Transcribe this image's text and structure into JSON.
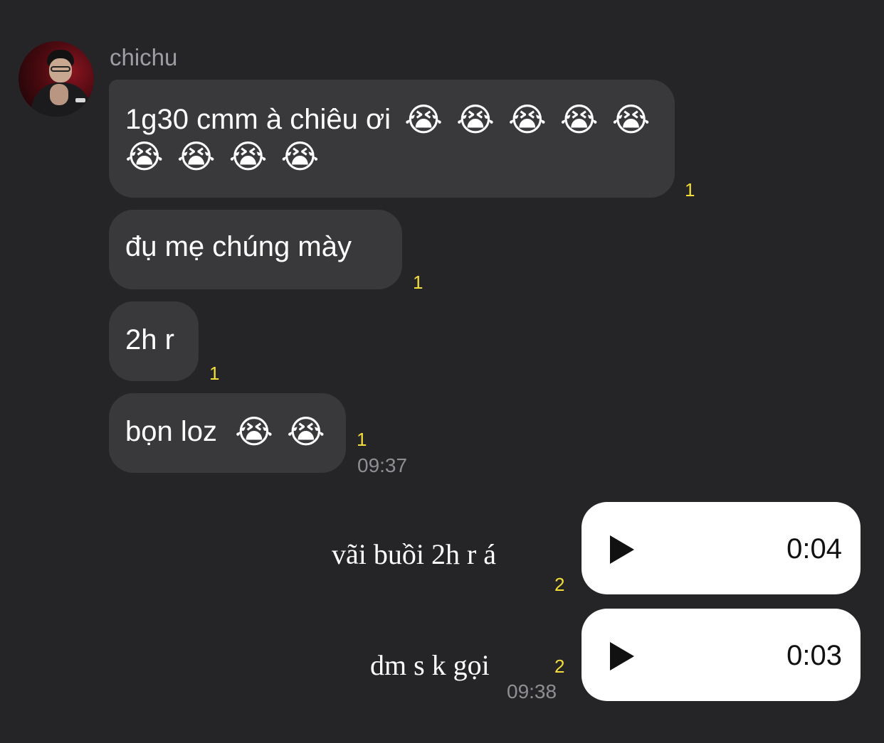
{
  "contact": {
    "name": "chichu"
  },
  "incoming": [
    {
      "text": "1g30 cmm à chiêu ơi",
      "emojis": [
        "😭",
        "😭",
        "😭",
        "😭",
        "😭",
        "😭",
        "😭",
        "😭",
        "😭"
      ],
      "read": "1"
    },
    {
      "text": "đụ mẹ chúng mày",
      "emojis": [],
      "read": "1"
    },
    {
      "text": "2h r",
      "emojis": [],
      "read": "1"
    },
    {
      "text": "bọn loz",
      "emojis": [
        "😭",
        "😭"
      ],
      "read": "1",
      "time": "09:37"
    }
  ],
  "outgoing": [
    {
      "caption": "vãi buồi 2h r á",
      "duration": "0:04",
      "read": "2"
    },
    {
      "caption": "dm s k gọi",
      "duration": "0:03",
      "read": "2",
      "time": "09:38"
    }
  ],
  "icons": {
    "emoji": "loudly-crying-face-icon",
    "play": "play-icon"
  },
  "colors": {
    "background": "#252527",
    "incoming_bubble": "#39393c",
    "outgoing_bubble": "#ffffff",
    "read_count": "#f2dd3a"
  }
}
